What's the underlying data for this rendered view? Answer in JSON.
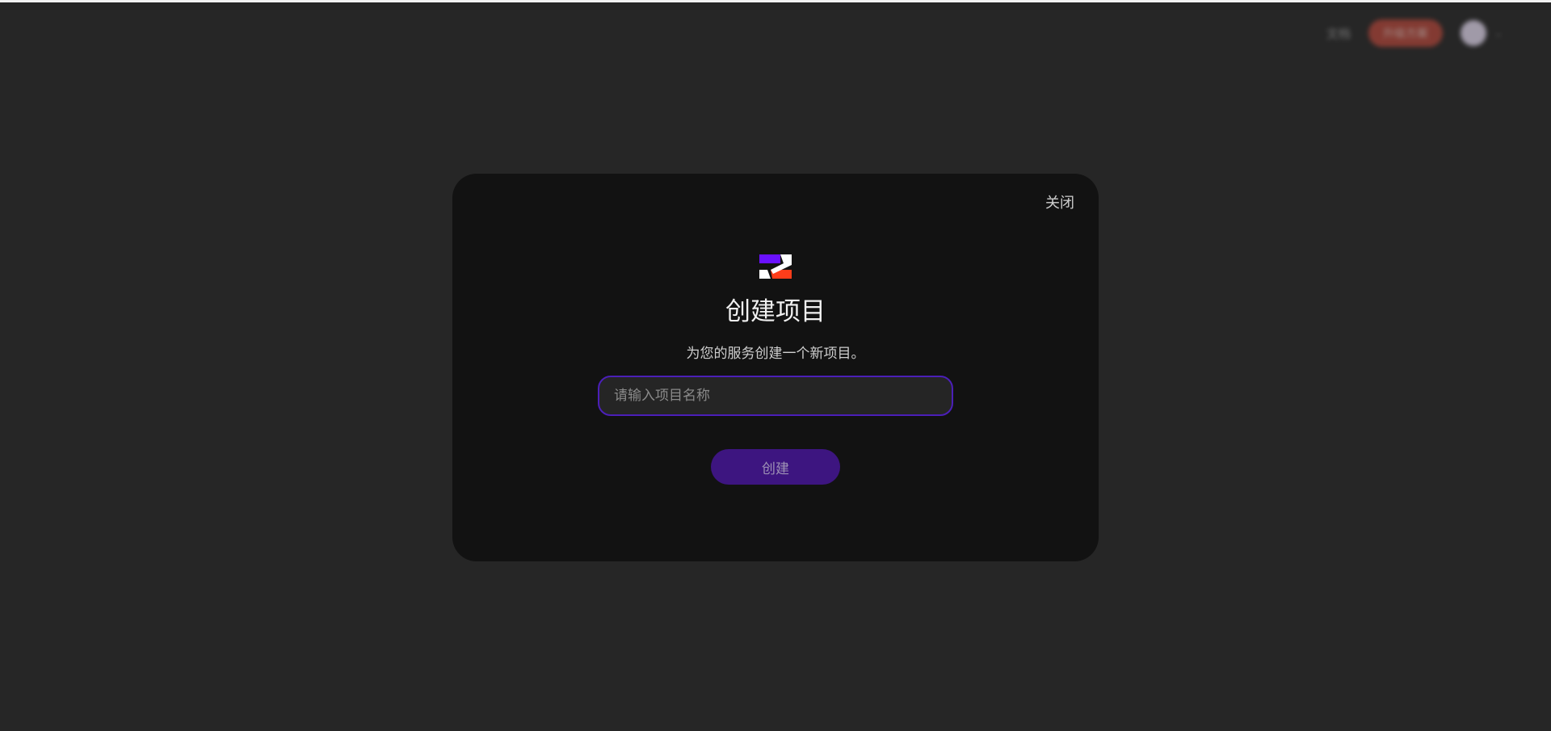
{
  "background_header": {
    "link_label": "文档",
    "button_label": "升级方案"
  },
  "modal": {
    "close_label": "关闭",
    "logo_icon": "brand-logo-icon",
    "title": "创建项目",
    "subtitle": "为您的服务创建一个新项目。",
    "input": {
      "value": "",
      "placeholder": "请输入项目名称"
    },
    "create_label": "创建"
  },
  "colors": {
    "page_background": "#262626",
    "modal_background": "#121212",
    "input_border": "#4b1fb8",
    "button_background": "#3d1580",
    "logo_purple": "#6a11ff",
    "logo_red": "#ff3d1a"
  }
}
